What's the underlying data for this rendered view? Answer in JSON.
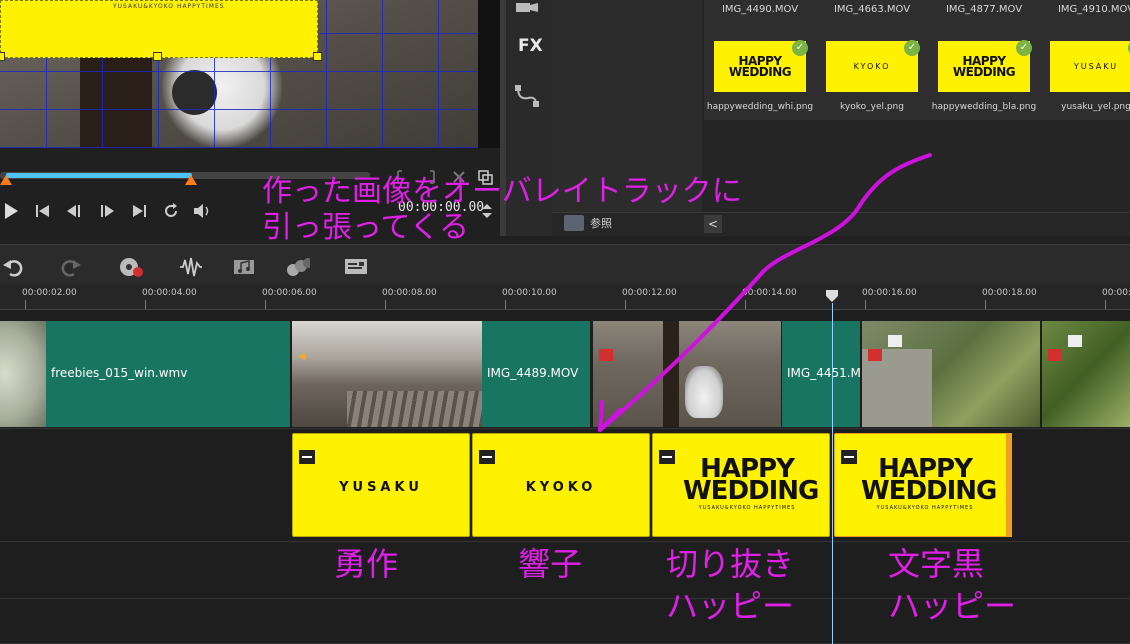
{
  "preview": {
    "overlay_text": "YUSAKU&KYOKO HAPPYTIMES",
    "timecode": "00:00:00.00"
  },
  "tool_strip": {
    "fx_label": "FX"
  },
  "library": {
    "items": [
      {
        "top_name": "IMG_4490.MOV",
        "thumb_type": "happy",
        "thumb_text": "HAPPY WEDDING",
        "bottom_name": "happywedding_whi.png"
      },
      {
        "top_name": "IMG_4663.MOV",
        "thumb_type": "name",
        "thumb_text": "KYOKO",
        "bottom_name": "kyoko_yel.png"
      },
      {
        "top_name": "IMG_4877.MOV",
        "thumb_type": "happy",
        "thumb_text": "HAPPY WEDDING",
        "bottom_name": "happywedding_bla.png"
      },
      {
        "top_name": "IMG_4910.MOV",
        "thumb_type": "name",
        "thumb_text": "YUSAKU",
        "bottom_name": "yusaku_yel.png"
      }
    ],
    "browse_label": "参照",
    "collapse_icon": "<"
  },
  "ruler": {
    "labels": [
      "00:00:02.00",
      "00:00:04.00",
      "00:00:06.00",
      "00:00:08.00",
      "00:00:10.00",
      "00:00:12.00",
      "00:00:14.00",
      "00:00:16.00",
      "00:00:18.00",
      "00:00:2"
    ]
  },
  "video_track": {
    "clips": [
      {
        "name": "freebies_015_win.wmv"
      },
      {
        "name": "IMG_4489.MOV"
      },
      {
        "name": "IMG_4451.M"
      }
    ]
  },
  "overlay_track": {
    "clips": [
      {
        "type": "name",
        "text": "YUSAKU"
      },
      {
        "type": "name",
        "text": "KYOKO"
      },
      {
        "type": "happy",
        "text": "HAPPY WEDDING",
        "sub": "YUSAKU&KYOKO HAPPYTIMES"
      },
      {
        "type": "happy",
        "text": "HAPPY WEDDING",
        "sub": "YUSAKU&KYOKO HAPPYTIMES"
      }
    ]
  },
  "annotations": {
    "heading_line1": "作った画像をオーバレイトラックに",
    "heading_line2": "引っ張ってくる",
    "captions": [
      {
        "line1": "勇作",
        "line2": ""
      },
      {
        "line1": "響子",
        "line2": ""
      },
      {
        "line1": "切り抜き",
        "line2": "ハッピー"
      },
      {
        "line1": "文字黒",
        "line2": "ハッピー"
      }
    ],
    "color": "#e020e8"
  }
}
